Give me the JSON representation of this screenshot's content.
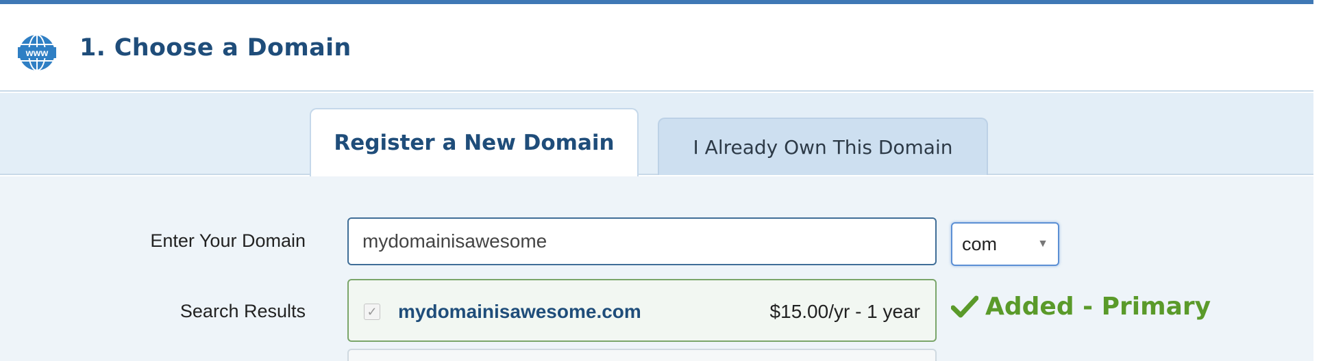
{
  "header": {
    "icon": "www-globe-icon",
    "icon_text": "www",
    "title": "1. Choose a Domain"
  },
  "tabs": [
    {
      "label": "Register a New Domain",
      "active": true
    },
    {
      "label": "I Already Own This Domain",
      "active": false
    }
  ],
  "form": {
    "domain_label": "Enter Your Domain",
    "domain_value": "mydomainisawesome",
    "tld_selected": "com",
    "results_label": "Search Results"
  },
  "results": [
    {
      "domain": "mydomainisawesome.com",
      "price": "$15.00/yr - 1 year",
      "checked": true,
      "status": "Added - Primary",
      "status_icon": "checkmark-icon"
    }
  ],
  "colors": {
    "accent": "#3f78b5",
    "title": "#1f4d7a",
    "success": "#5a9a2a",
    "tab_band": "#e3eef7",
    "inactive_tab": "#cddff0"
  }
}
